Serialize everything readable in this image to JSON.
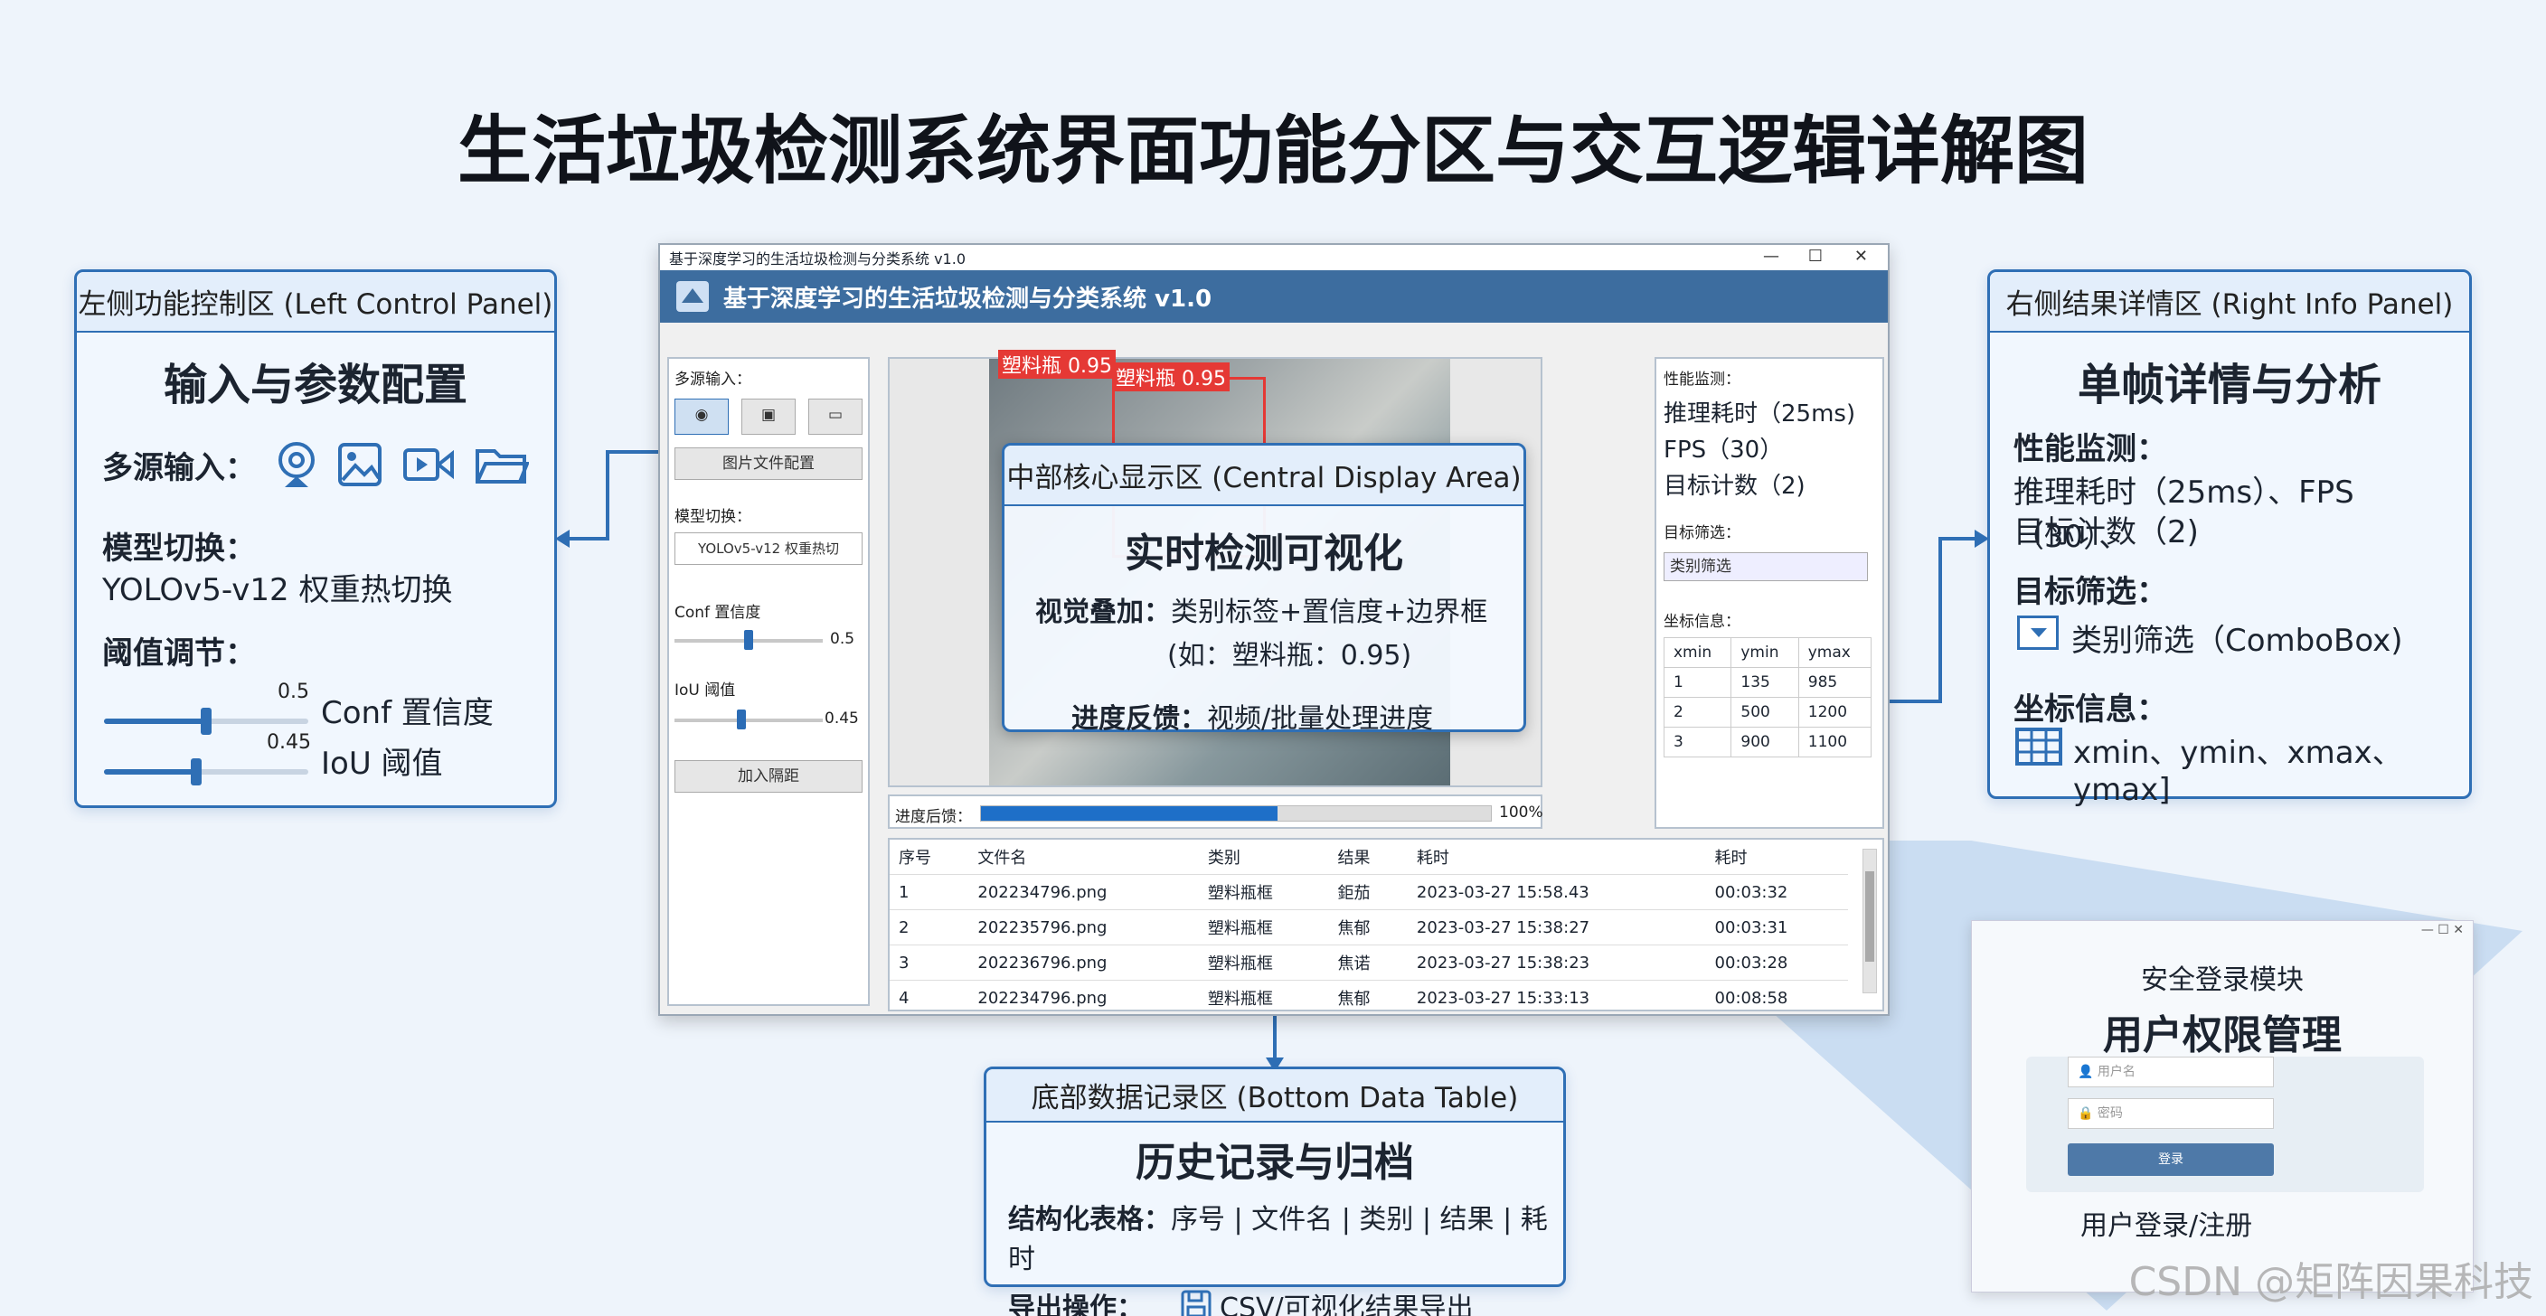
{
  "title": "生活垃圾检测系统界面功能分区与交互逻辑详解图",
  "left_panel": {
    "header": "左侧功能控制区 (Left Control Panel)",
    "heading": "输入与参数配置",
    "multisource_label": "多源输入：",
    "icons": [
      "webcam-icon",
      "image-icon",
      "video-icon",
      "folder-icon"
    ],
    "model_label": "模型切换：",
    "model_text": "YOLOv5-v12 权重热切换",
    "threshold_label": "阈值调节：",
    "conf_value": "0.5",
    "conf_text": "Conf 置信度",
    "conf_level": 0.5,
    "iou_value": "0.45",
    "iou_text": "IoU 阈值",
    "iou_level": 0.45
  },
  "app": {
    "window_title": "基于深度学习的生活垃圾检测与分类系统 v1.0",
    "header_title": "基于深度学习的生活垃圾检测与分类系统 v1.0",
    "controls": [
      "—",
      "☐",
      "✕"
    ],
    "left": {
      "multisource_label": "多源输入：",
      "image_config_button": "图片文件配置",
      "model_label": "模型切换：",
      "model_select": "YOLOv5-v12 权重热切",
      "conf_label": "Conf 置信度",
      "conf_value": "0.5",
      "iou_label": "IoU 阈值",
      "iou_value": "0.45",
      "load_button": "加入隔距"
    },
    "detections": [
      "塑料瓶 0.95",
      "塑料瓶 0.95"
    ],
    "progress_label": "进度后馈：",
    "progress_value": "100%",
    "progress_level": 0.58,
    "right": {
      "perf_label": "性能监测：",
      "infer_time": "推理耗时（25ms)",
      "fps": "FPS（30）",
      "target_count": "目标计数（2)",
      "filter_label": "目标筛选：",
      "filter_select": "类别筛选",
      "coord_label": "坐标信息：",
      "coord_headers": [
        "xmin",
        "ymin",
        "ymax"
      ],
      "coord_rows": [
        [
          "1",
          "135",
          "985"
        ],
        [
          "2",
          "500",
          "1200"
        ],
        [
          "3",
          "900",
          "1100"
        ]
      ]
    },
    "table": {
      "headers": [
        "序号",
        "文件名",
        "类别",
        "结果",
        "耗时",
        "耗时"
      ],
      "rows": [
        [
          "1",
          "202234796.png",
          "塑料瓶框",
          "鉅茄",
          "2023-03-27 15:58.43",
          "00:03:32"
        ],
        [
          "2",
          "202235796.png",
          "塑料瓶框",
          "焦郁",
          "2023-03-27 15:38:27",
          "00:03:31"
        ],
        [
          "3",
          "202236796.png",
          "塑料瓶框",
          "焦诺",
          "2023-03-27 15:38:23",
          "00:03:28"
        ],
        [
          "4",
          "202234796.png",
          "塑料瓶框",
          "焦郁",
          "2023-03-27 15:33:13",
          "00:08:58"
        ]
      ]
    }
  },
  "central_overlay": {
    "header": "中部核心显示区 (Central Display Area)",
    "heading": "实时检测可视化",
    "visual_label": "视觉叠加：",
    "visual_text": "类别标签+置信度+边界框",
    "visual_example": "(如：塑料瓶：0.95)",
    "progress_label": "进度反馈：",
    "progress_text": "视频/批量处理进度"
  },
  "right_panel": {
    "header": "右侧结果详情区 (Right Info Panel)",
    "heading": "单帧详情与分析",
    "perf_label": "性能监测：",
    "perf_text_1": "推理耗时（25ms）、FPS（30）、",
    "perf_text_2": "目标计数（2)",
    "filter_label": "目标筛选：",
    "filter_text": "类别筛选（ComboBox)",
    "coord_label": "坐标信息：",
    "coord_text": "xmin、ymin、xmax、ymax]"
  },
  "bottom_panel": {
    "header": "底部数据记录区 (Bottom Data Table)",
    "heading": "历史记录与归档",
    "table_label": "结构化表格：",
    "table_text": "序号 | 文件名 | 类别 | 结果 | 耗时",
    "export_label": "导出操作：",
    "export_text": "CSV/可视化结果导出"
  },
  "login": {
    "subtitle": "安全登录模块",
    "heading": "用户权限管理",
    "username_placeholder": "用户名",
    "password_placeholder": "密码",
    "login_button": "登录",
    "footer": "用户登录/注册"
  },
  "watermark": "CSDN @矩阵因果科技",
  "colors": {
    "accent": "#2f6fb5",
    "header_bar": "#3d6d9f",
    "progress": "#1e6fc8",
    "detect_box": "#e53935"
  }
}
